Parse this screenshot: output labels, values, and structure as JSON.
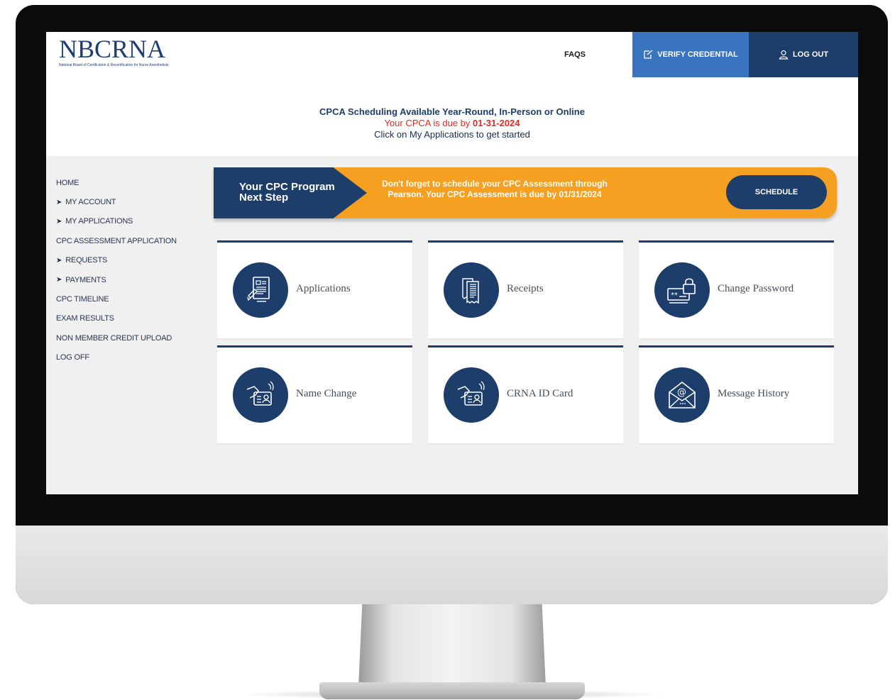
{
  "logo": {
    "text": "NBCRNA",
    "subtext": "National Board of Certification & Recertification for Nurse Anesthetists"
  },
  "nav": {
    "faqs": "FAQS",
    "verify": "VERIFY CREDENTIAL",
    "logout": "LOG OUT"
  },
  "notice": {
    "title": "CPCA Scheduling Available Year-Round, In-Person or Online",
    "due_prefix": "Your CPCA is due by ",
    "due_date": "01-31-2024",
    "hint": "Click on My Applications to get started"
  },
  "sidebar": {
    "items": [
      {
        "label": "HOME",
        "arrow": false
      },
      {
        "label": "MY ACCOUNT",
        "arrow": true
      },
      {
        "label": "MY APPLICATIONS",
        "arrow": true
      },
      {
        "label": "CPC ASSESSMENT APPLICATION",
        "arrow": false
      },
      {
        "label": "REQUESTS",
        "arrow": true
      },
      {
        "label": "PAYMENTS",
        "arrow": true
      },
      {
        "label": "CPC TIMELINE",
        "arrow": false
      },
      {
        "label": "EXAM RESULTS",
        "arrow": false
      },
      {
        "label": "NON MEMBER CREDIT UPLOAD",
        "arrow": false
      },
      {
        "label": "LOG OFF",
        "arrow": false
      }
    ]
  },
  "banner": {
    "title_line1": "Your CPC Program",
    "title_line2": "Next Step",
    "message_line1": "Don't forget to schedule your CPC Assessment through",
    "message_line2": "Pearson. Your CPC Assessment is due by 01/31/2024",
    "button": "SCHEDULE",
    "color_primary": "#1d3d6b",
    "color_accent": "#f5a020"
  },
  "tiles": [
    {
      "label": "Applications",
      "icon": "application-form-icon"
    },
    {
      "label": "Receipts",
      "icon": "receipt-icon"
    },
    {
      "label": "Change Password",
      "icon": "password-lock-icon"
    },
    {
      "label": "Name Change",
      "icon": "id-card-tap-icon"
    },
    {
      "label": "CRNA ID Card",
      "icon": "id-card-tap-icon"
    },
    {
      "label": "Message History",
      "icon": "email-envelope-icon"
    }
  ]
}
